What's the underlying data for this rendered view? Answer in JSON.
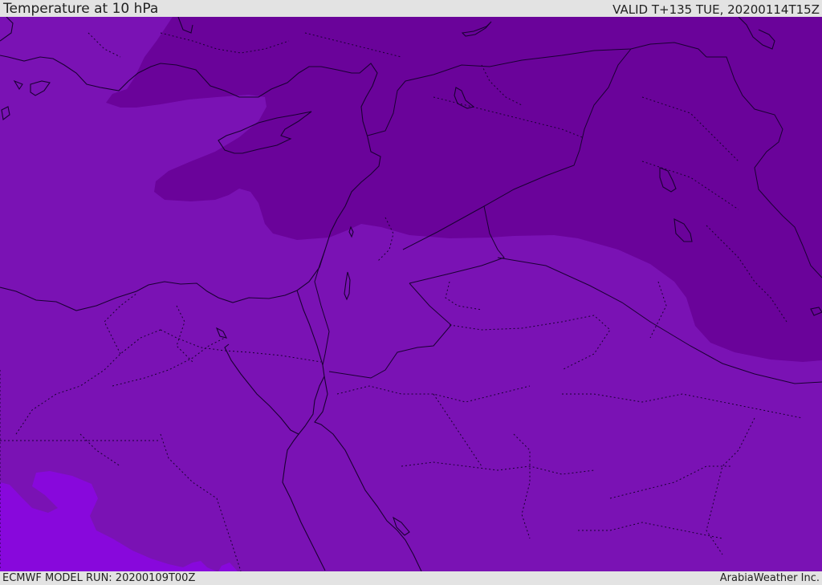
{
  "header": {
    "title": "Temperature at 10 hPa",
    "valid": "VALID T+135 TUE, 20200114T15Z"
  },
  "footer": {
    "model_run": "ECMWF MODEL RUN: 20200109T00Z",
    "credit": "ArabiaWeather Inc."
  },
  "map": {
    "colors": {
      "base_field": "#7a12b4",
      "cold_field": "#6a039a",
      "warm_field": "#8808dc",
      "lines": "#1a0033"
    }
  }
}
